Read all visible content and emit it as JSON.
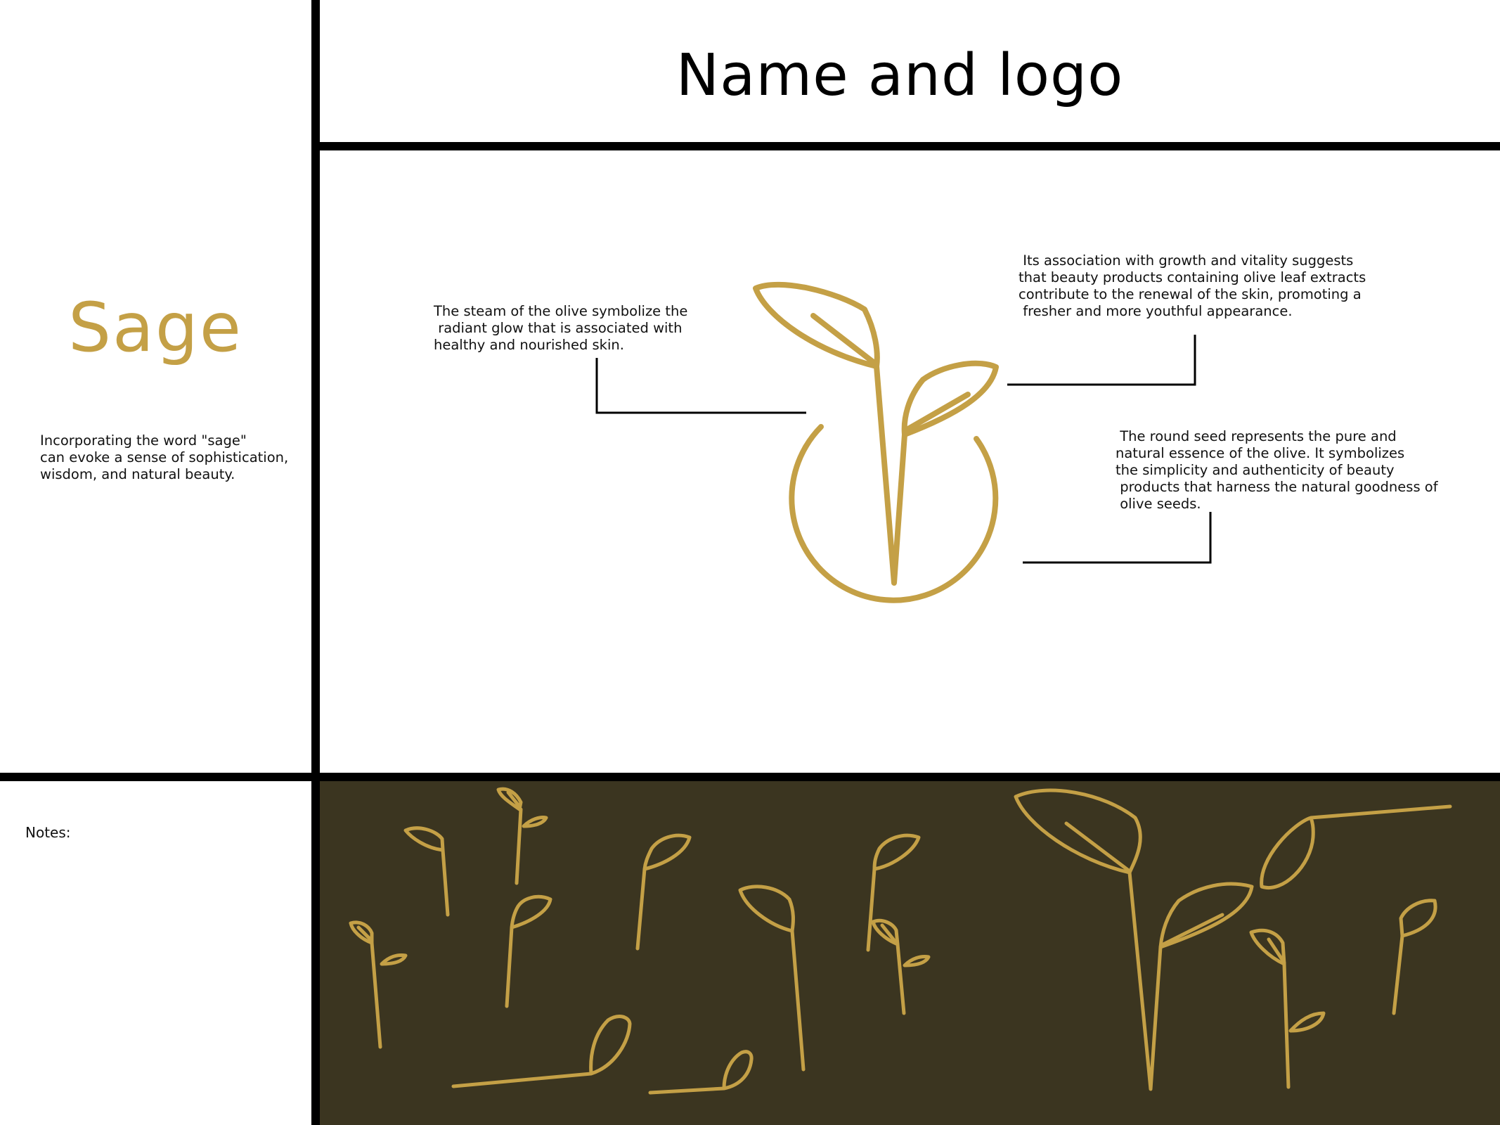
{
  "header": {
    "title": "Name and logo"
  },
  "brand": {
    "name": "Sage",
    "description": "Incorporating the word \"sage\"\ncan evoke a sense of sophistication,\nwisdom, and natural beauty."
  },
  "annotations": {
    "stem": "The steam of the olive symbolize the\n radiant glow that is associated with\nhealthy and nourished skin.",
    "leaves": " Its association with growth and vitality suggests\nthat beauty products containing olive leaf extracts\ncontribute to the renewal of the skin, promoting a\n fresher and more youthful appearance.",
    "seed": " The round seed represents the pure and\nnatural essence of the olive. It symbolizes\nthe simplicity and authenticity of beauty\n products that harness the natural goodness of\n olive seeds."
  },
  "notes": {
    "label": "Notes:"
  },
  "colors": {
    "gold": "#c4a046",
    "pattern_background": "#3b3520",
    "divider": "#000000"
  },
  "icons": {
    "logo": "sprout-in-seed-logo",
    "pattern": "sprout-pattern"
  }
}
